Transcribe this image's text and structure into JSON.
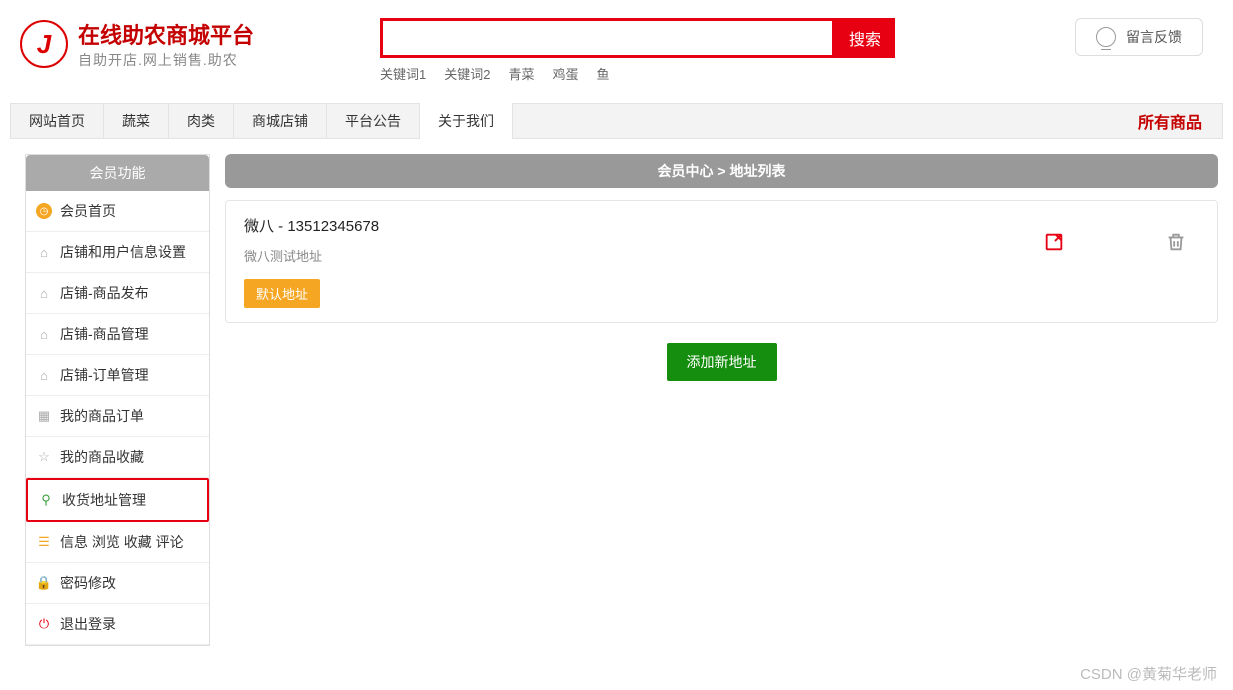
{
  "header": {
    "site_title": "在线助农商城平台",
    "site_subtitle": "自助开店.网上销售.助农",
    "search_btn": "搜索",
    "keywords": [
      "关键词1",
      "关键词2",
      "青菜",
      "鸡蛋",
      "鱼"
    ],
    "feedback": "留言反馈"
  },
  "nav": {
    "items": [
      "网站首页",
      "蔬菜",
      "肉类",
      "商城店铺",
      "平台公告",
      "关于我们"
    ],
    "all_goods": "所有商品"
  },
  "sidebar": {
    "title": "会员功能",
    "items": [
      {
        "label": "会员首页",
        "icon": "clock",
        "icon_class": "orange"
      },
      {
        "label": "店铺和用户信息设置",
        "icon": "home",
        "icon_class": "gray"
      },
      {
        "label": "店铺-商品发布",
        "icon": "home",
        "icon_class": "gray"
      },
      {
        "label": "店铺-商品管理",
        "icon": "home",
        "icon_class": "gray"
      },
      {
        "label": "店铺-订单管理",
        "icon": "home",
        "icon_class": "gray"
      },
      {
        "label": "我的商品订单",
        "icon": "grid",
        "icon_class": "gray"
      },
      {
        "label": "我的商品收藏",
        "icon": "star",
        "icon_class": "gray"
      },
      {
        "label": "收货地址管理",
        "icon": "pin",
        "icon_class": "green",
        "highlighted": true
      },
      {
        "label": "信息 浏览 收藏 评论",
        "icon": "list",
        "icon_class": "orange"
      },
      {
        "label": "密码修改",
        "icon": "lock",
        "icon_class": "red"
      },
      {
        "label": "退出登录",
        "icon": "power",
        "icon_class": "red"
      }
    ]
  },
  "main": {
    "breadcrumb": "会员中心 > 地址列表",
    "address": {
      "title": "微八 - 13512345678",
      "detail": "微八测试地址",
      "default_label": "默认地址"
    },
    "add_btn": "添加新地址"
  },
  "watermark": "CSDN @黄菊华老师"
}
